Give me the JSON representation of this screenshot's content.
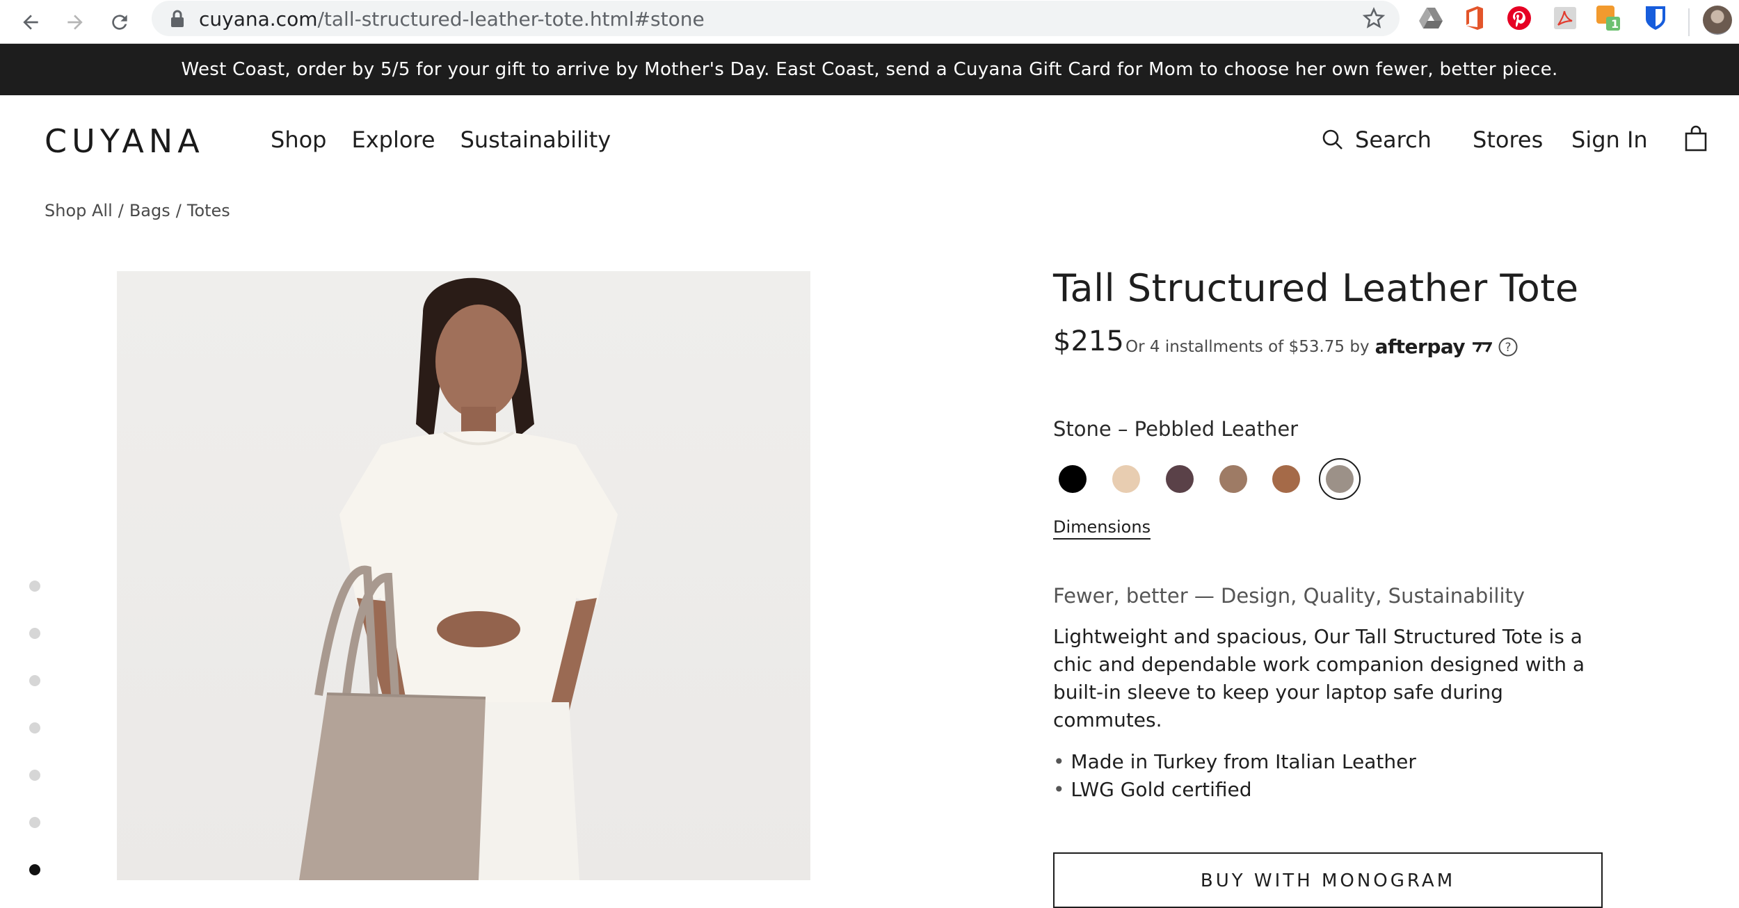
{
  "browser": {
    "url_host": "cuyana.com",
    "url_path": "/tall-structured-leather-tote.html#stone",
    "extension_badge": "1",
    "extensions": [
      "google-drive-icon",
      "office-icon",
      "pinterest-icon",
      "acrobat-icon",
      "extension-badge-icon",
      "bitwarden-icon"
    ]
  },
  "announcement": "West Coast, order by 5/5 for your gift to arrive by Mother's Day. East Coast, send a Cuyana Gift Card for Mom to choose her own fewer, better piece.",
  "header": {
    "logo": "CUYANA",
    "nav": [
      "Shop",
      "Explore",
      "Sustainability"
    ],
    "search": "Search",
    "stores": "Stores",
    "sign_in": "Sign In"
  },
  "breadcrumb": [
    "Shop All",
    "Bags",
    "Totes"
  ],
  "gallery": {
    "image_count": 7,
    "active_index": 6
  },
  "product": {
    "title": "Tall Structured Leather Tote",
    "price": "$215",
    "installments": "Or 4 installments of $53.75 by",
    "afterpay": "afterpay",
    "color_label": "Stone – Pebbled Leather",
    "swatches": [
      {
        "name": "black",
        "color": "#000000"
      },
      {
        "name": "beige",
        "color": "#e8cdb1"
      },
      {
        "name": "plum",
        "color": "#5a4148"
      },
      {
        "name": "taupe",
        "color": "#9e7b65"
      },
      {
        "name": "caramel",
        "color": "#a56a48"
      },
      {
        "name": "stone",
        "color": "#9c9188",
        "selected": true
      }
    ],
    "dimensions_link": "Dimensions",
    "tagline": "Fewer, better — Design, Quality, Sustainability",
    "description": "Lightweight and spacious, Our Tall Structured Tote is a chic and dependable work companion designed with a built-in sleeve to keep your laptop safe during commutes.",
    "features": [
      "Made in Turkey from Italian Leather",
      "LWG Gold certified"
    ],
    "monogram_button": "BUY WITH MONOGRAM"
  }
}
